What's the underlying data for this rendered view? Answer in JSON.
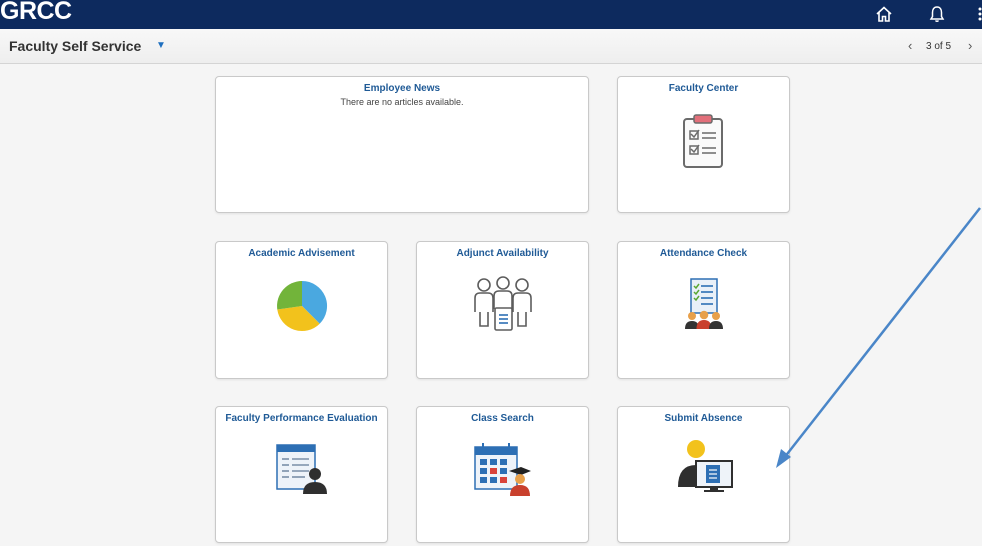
{
  "header": {
    "logo_text": "GRCC",
    "home_icon": "home-icon",
    "notifications_icon": "bell-icon",
    "accent_color": "#0d2a5e"
  },
  "subheader": {
    "title": "Faculty Self Service",
    "pager_text": "3 of 5"
  },
  "tiles": {
    "employee_news": {
      "title": "Employee News",
      "message": "There are no articles available."
    },
    "faculty_center": {
      "title": "Faculty Center",
      "icon": "clipboard-checklist-icon"
    },
    "academic_advisement": {
      "title": "Academic Advisement",
      "icon": "pie-chart-icon"
    },
    "adjunct_availability": {
      "title": "Adjunct Availability",
      "icon": "people-document-icon"
    },
    "attendance_check": {
      "title": "Attendance Check",
      "icon": "attendance-list-icon"
    },
    "faculty_performance_evaluation": {
      "title": "Faculty Performance Evaluation",
      "icon": "document-person-icon"
    },
    "class_search": {
      "title": "Class Search",
      "icon": "calendar-graduate-icon"
    },
    "submit_absence": {
      "title": "Submit Absence",
      "icon": "person-monitor-icon"
    }
  },
  "annotation": {
    "color": "#4a86c8"
  }
}
